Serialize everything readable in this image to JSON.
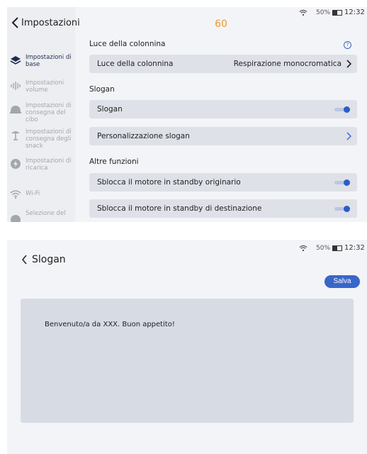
{
  "screen_settings": {
    "back_label": "Impostazioni",
    "countdown": "60",
    "status": {
      "battery": "50%",
      "time": "12:32"
    },
    "sidebar": [
      {
        "label": "Impostazioni di base",
        "icon": "layers-icon",
        "active": true
      },
      {
        "label": "Impostazioni volume",
        "icon": "volume-bars-icon",
        "active": false
      },
      {
        "label": "Impostazioni di consegna del cibo",
        "icon": "food-cover-icon",
        "active": false
      },
      {
        "label": "Impostazioni di consegna degli snack",
        "icon": "snack-icon",
        "active": false
      },
      {
        "label": "Impostazioni di ricarica",
        "icon": "charge-icon",
        "active": false
      },
      {
        "label": "Wi-Fi",
        "icon": "wifi-icon",
        "active": false
      },
      {
        "label": "Selezione del",
        "icon": "map-icon",
        "active": false
      }
    ],
    "section_column": "Luce della colonnina",
    "help_icon": "?",
    "row_column_label": "Luce della colonnina",
    "row_column_value": "Respirazione monocromatica",
    "section_slogan": "Slogan",
    "row_slogan_label": "Slogan",
    "row_slogan_toggle": true,
    "row_custom_slogan_label": "Personalizzazione slogan",
    "section_other": "Altre funzioni",
    "row_unlock_origin_label": "Sblocca il motore in standby originario",
    "row_unlock_origin_toggle": true,
    "row_unlock_dest_label": "Sblocca il motore in standby di destinazione",
    "row_unlock_dest_toggle": true
  },
  "screen_slogan": {
    "title": "Slogan",
    "save_label": "Salva",
    "status": {
      "battery": "50%",
      "time": "12:32"
    },
    "slogan_text": "Benvenuto/a da XXX. Buon appetito!"
  },
  "colors": {
    "accent": "#3966c9",
    "countdown": "#f0962e",
    "row_bg": "#dfe1e8"
  }
}
